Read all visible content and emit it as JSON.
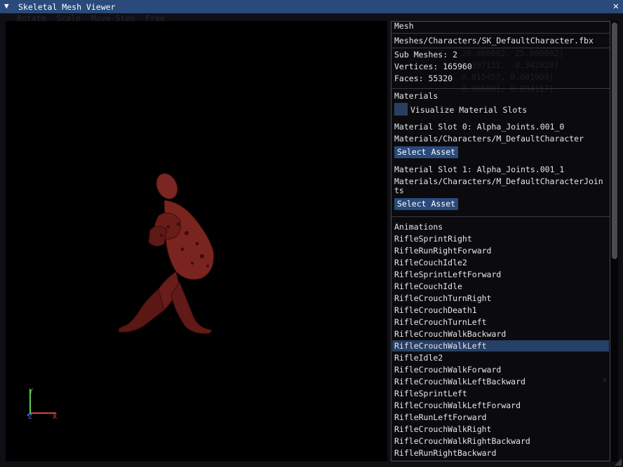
{
  "window": {
    "title": "Skeletal Mesh Viewer",
    "collapse_icon": "triangle-down-icon",
    "close_icon": "close-icon",
    "title_color": "#294a7a"
  },
  "background_toolbar": [
    "Rotate",
    "Scale",
    "Move Step",
    "Free"
  ],
  "viewport": {
    "gizmo": {
      "x_label": "X",
      "y_label": "Y",
      "z_label": "Z",
      "x_color": "#e0413a",
      "y_color": "#5bd24b",
      "z_color": "#4a6de0"
    },
    "model_color": "#8a2a26"
  },
  "mesh": {
    "header": "Mesh",
    "path": "Meshes/Characters/SK_DefaultCharacter.fbx",
    "sub_meshes": "Sub Meshes: 2",
    "vertices": "Vertices: 165960",
    "faces": "Faces: 55320"
  },
  "ghost_text": [
    "20.000002, 25.000002]",
    "0.397131, -0.342820]",
    "0.915457, 0.001900]",
    "0.06500], 0.834117]"
  ],
  "materials": {
    "header": "Materials",
    "visualize_label": "Visualize Material Slots",
    "visualize_checked": false,
    "slot0_label": "Material Slot 0: Alpha_Joints.001_0",
    "slot0_path": "Materials/Characters/M_DefaultCharacter",
    "slot1_label": "Material Slot 1: Alpha_Joints.001_1",
    "slot1_path_line1": "Materials/Characters/M_DefaultCharacterJoin",
    "slot1_path_line2": "ts",
    "select_button": "Select Asset"
  },
  "animations": {
    "header": "Animations",
    "selected": "RifleCrouchWalkLeft",
    "items": [
      "RifleSprintRight",
      "RifleRunRightForward",
      "RifleCouchIdle2",
      "RifleSprintLeftForward",
      "RifleCouchIdle",
      "RifleCrouchTurnRight",
      "RifleCrouchDeath1",
      "RifleCrouchTurnLeft",
      "RifleCrouchWalkBackward",
      "RifleCrouchWalkLeft",
      "RifleIdle2",
      "RifleCrouchWalkForward",
      "RifleCrouchWalkLeftBackward",
      "RifleSprintLeft",
      "RifleCrouchWalkLeftForward",
      "RifleRunLeftForward",
      "RifleCrouchWalkRight",
      "RifleCrouchWalkRightBackward",
      "RifleRunRightBackward"
    ]
  }
}
